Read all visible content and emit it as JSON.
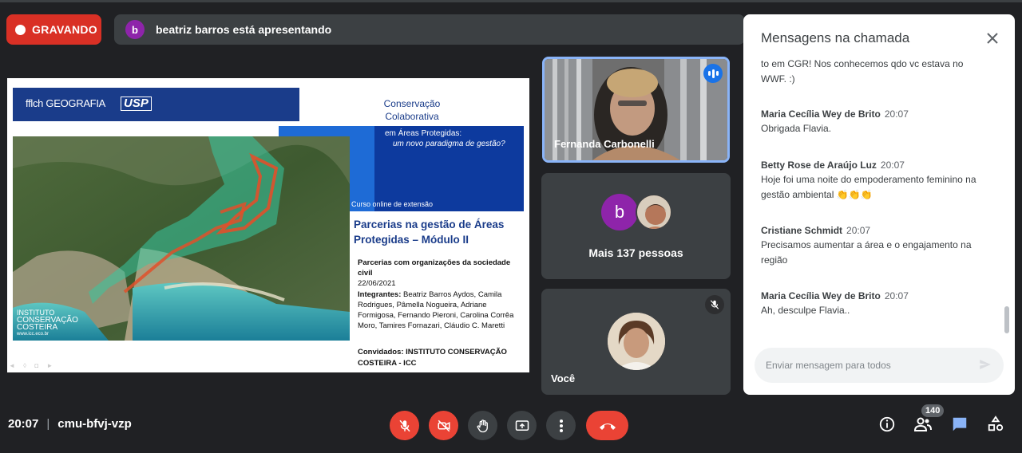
{
  "recording": {
    "label": "GRAVANDO"
  },
  "presenting": {
    "avatar_letter": "b",
    "text": "beatriz barros está apresentando"
  },
  "slide": {
    "logo_fflch": "fflch GEOGRAFIA",
    "logo_usp": "USP",
    "title_line1": "Conservação",
    "title_line2": "Colaborativa",
    "subtitle_line1": "em Áreas Protegidas:",
    "subtitle_line2": "um novo paradigma de gestão?",
    "curso": "Curso online de extensão",
    "parcerias_title": "Parcerias na gestão de Áreas Protegidas – Módulo II",
    "topic_label": "Parcerias com organizações da sociedade civil",
    "date": "22/06/2021",
    "integrantes_label": "Integrantes:",
    "integrantes": "Beatriz Barros Aydos, Camila Rodrigues, Pâmella Nogueira, Adriane Formigosa, Fernando Pieroni, Carolina Corrêa Moro, Tamires Fornazari, Cláudio C. Maretti",
    "convidados_label": "Convidados:",
    "convidados": "INSTITUTO CONSERVAÇÃO COSTEIRA - ICC",
    "icc_line1": "INSTITUTO",
    "icc_line2": "CONSERVAÇÃO",
    "icc_line3": "COSTEIRA",
    "icc_url": "www.icc.eco.br"
  },
  "tiles": {
    "speaker_name": "Fernanda Carbonelli",
    "others_avatar_letter": "b",
    "others_label": "Mais 137 pessoas",
    "self_name": "Você"
  },
  "chat": {
    "title": "Mensagens na chamada",
    "partial_text": "to em CGR! Nos conhecemos qdo vc estava no WWF. :)",
    "messages": [
      {
        "author": "Maria Cecília Wey de Brito",
        "time": "20:07",
        "text": "Obrigada Flavia."
      },
      {
        "author": "Betty Rose de Araújo Luz",
        "time": "20:07",
        "text": "Hoje foi uma noite do empoderamento feminino na gestão ambiental 👏👏👏"
      },
      {
        "author": "Cristiane Schmidt",
        "time": "20:07",
        "text": "Precisamos aumentar a área e o engajamento na região"
      },
      {
        "author": "Maria Cecília Wey de Brito",
        "time": "20:07",
        "text": "Ah, desculpe Flavia.."
      }
    ],
    "input_placeholder": "Enviar mensagem para todos"
  },
  "bottom": {
    "time": "20:07",
    "separator": "|",
    "meeting_code": "cmu-bfvj-vzp",
    "participants_count": "140"
  },
  "colors": {
    "accent": "#8ab4f8",
    "danger": "#ea4335",
    "bg": "#202124",
    "tile": "#3c4043",
    "chat_icon": "#8ab4f8"
  },
  "icons": [
    "record-dot-icon",
    "mic-off-icon",
    "camera-off-icon",
    "raise-hand-icon",
    "present-screen-icon",
    "more-vert-icon",
    "hang-up-icon",
    "info-icon",
    "people-icon",
    "chat-icon",
    "activities-icon",
    "close-icon",
    "send-icon",
    "speaking-icon"
  ]
}
